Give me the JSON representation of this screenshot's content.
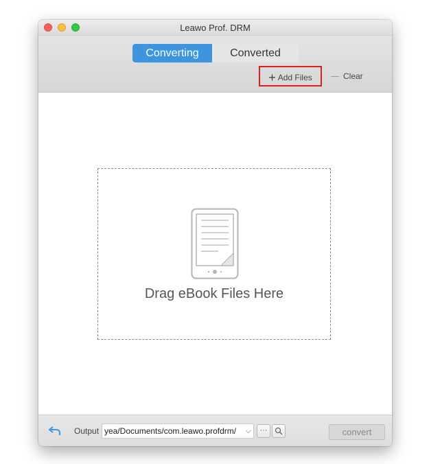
{
  "window": {
    "title": "Leawo Prof. DRM"
  },
  "tabs": [
    {
      "label": "Converting",
      "active": true
    },
    {
      "label": "Converted",
      "active": false
    }
  ],
  "toolbar": {
    "add_files_label": "Add Files",
    "clear_label": "Clear"
  },
  "dropzone": {
    "label": "Drag eBook Files Here",
    "icon": "ebook-reader-icon"
  },
  "bottom": {
    "output_label": "Output",
    "output_path": "yea/Documents/com.leawo.profdrm/",
    "more_label": "···",
    "convert_label": "convert"
  },
  "colors": {
    "active_tab": "#3d95e0",
    "highlight_box": "#e21d1d"
  }
}
